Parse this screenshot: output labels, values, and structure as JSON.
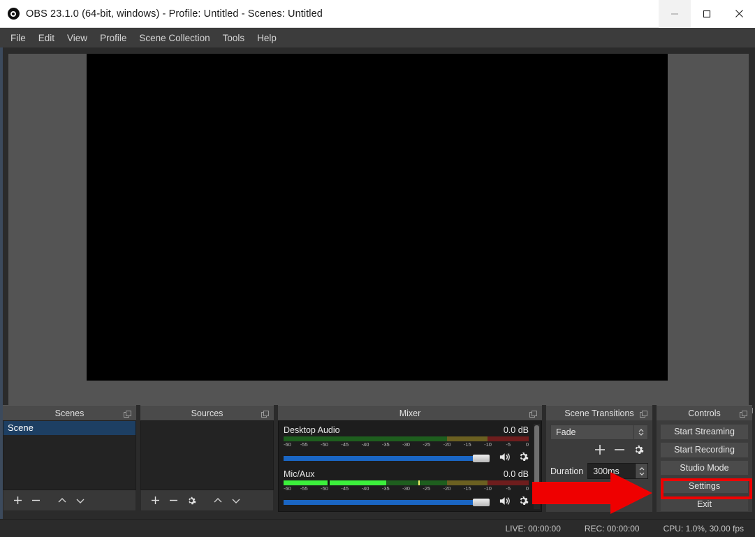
{
  "window": {
    "title": "OBS 23.1.0 (64-bit, windows) - Profile: Untitled - Scenes: Untitled",
    "app_icon": "obs-logo-icon",
    "minimize_label": "minimize-icon",
    "maximize_label": "maximize-icon",
    "close_label": "close-icon"
  },
  "menubar": {
    "items": [
      {
        "label": "File"
      },
      {
        "label": "Edit"
      },
      {
        "label": "View"
      },
      {
        "label": "Profile"
      },
      {
        "label": "Scene Collection"
      },
      {
        "label": "Tools"
      },
      {
        "label": "Help"
      }
    ]
  },
  "preview": {
    "float_icon": "undock-icon",
    "canvas_color": "#000000",
    "backdrop_color": "#545454"
  },
  "scenes": {
    "title": "Scenes",
    "float_icon": "undock-icon",
    "items": [
      {
        "label": "Scene",
        "selected": true
      }
    ],
    "toolbar": [
      {
        "icon": "plus-icon",
        "name": "add-scene-button"
      },
      {
        "icon": "minus-icon",
        "name": "remove-scene-button"
      },
      {
        "icon": "chevron-up-icon",
        "name": "move-scene-up-button"
      },
      {
        "icon": "chevron-down-icon",
        "name": "move-scene-down-button"
      }
    ]
  },
  "sources": {
    "title": "Sources",
    "float_icon": "undock-icon",
    "items": [],
    "toolbar": [
      {
        "icon": "plus-icon",
        "name": "add-source-button"
      },
      {
        "icon": "minus-icon",
        "name": "remove-source-button"
      },
      {
        "icon": "gear-icon",
        "name": "source-properties-button"
      },
      {
        "icon": "chevron-up-icon",
        "name": "move-source-up-button"
      },
      {
        "icon": "chevron-down-icon",
        "name": "move-source-down-button"
      }
    ]
  },
  "mixer": {
    "title": "Mixer",
    "float_icon": "undock-icon",
    "scale_ticks": [
      "-60",
      "-55",
      "-50",
      "-45",
      "-40",
      "-35",
      "-30",
      "-25",
      "-20",
      "-15",
      "-10",
      "-5",
      "0"
    ],
    "sources": [
      {
        "name": "Desktop Audio",
        "db": "0.0 dB",
        "level_pct": 0,
        "peak_pct": 0,
        "volume_pct": 96,
        "mute_icon": "speaker-icon",
        "settings_icon": "gear-icon"
      },
      {
        "name": "Mic/Aux",
        "db": "0.0 dB",
        "level_pct": 42,
        "peak_pct": 55,
        "volume_pct": 96,
        "mute_icon": "speaker-icon",
        "settings_icon": "gear-icon"
      }
    ]
  },
  "transitions": {
    "title": "Scene Transitions",
    "float_icon": "undock-icon",
    "selected": "Fade",
    "options": [
      "Fade"
    ],
    "add_icon": "plus-icon",
    "remove_icon": "minus-icon",
    "properties_icon": "gear-icon",
    "duration_label": "Duration",
    "duration_value": "300ms"
  },
  "controls": {
    "title": "Controls",
    "float_icon": "undock-icon",
    "buttons": [
      {
        "label": "Start Streaming",
        "name": "start-streaming-button"
      },
      {
        "label": "Start Recording",
        "name": "start-recording-button"
      },
      {
        "label": "Studio Mode",
        "name": "studio-mode-button"
      },
      {
        "label": "Settings",
        "name": "settings-button",
        "highlighted": true
      },
      {
        "label": "Exit",
        "name": "exit-button"
      }
    ]
  },
  "statusbar": {
    "live": "LIVE: 00:00:00",
    "rec": "REC: 00:00:00",
    "cpu": "CPU: 1.0%, 30.00 fps"
  },
  "annotation": {
    "arrow_color": "#ef0000",
    "highlight_color": "#ef0000",
    "target": "settings-button"
  }
}
